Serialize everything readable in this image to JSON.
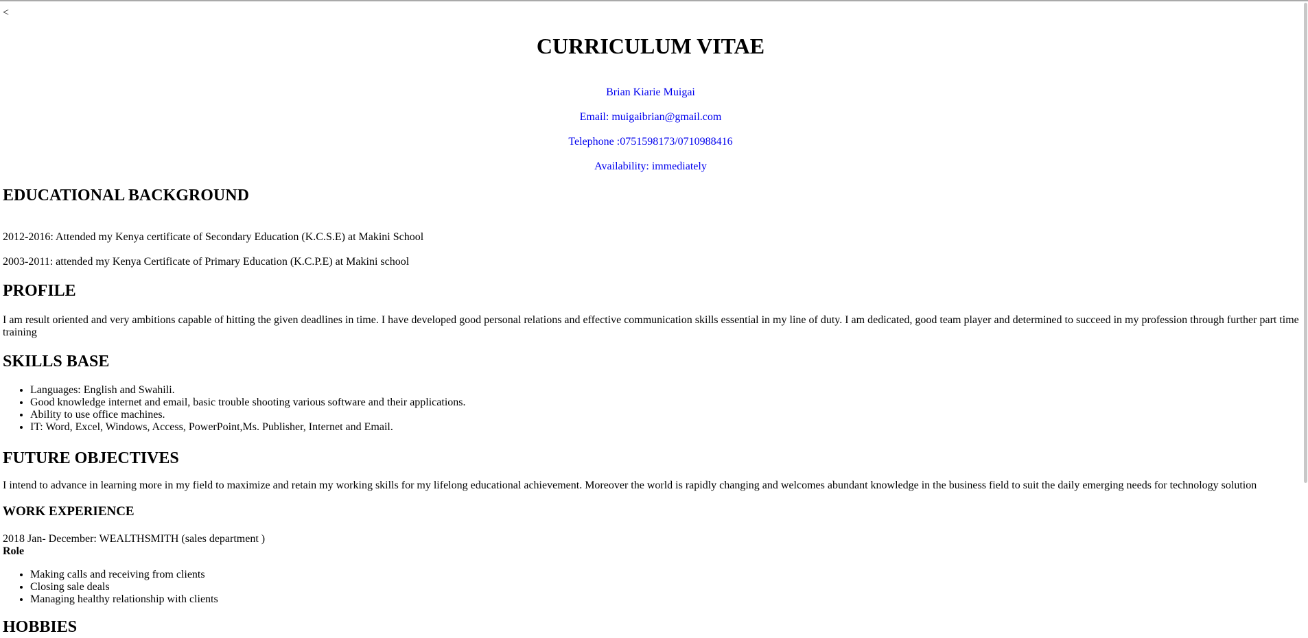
{
  "back_text": "<",
  "title": "CURRICULUM VITAE",
  "contact": {
    "name": "Brian Kiarie Muigai",
    "email": "Email: muigaibrian@gmail.com",
    "telephone": "Telephone :0751598173/0710988416",
    "availability": "Availability: immediately",
    "link_color": "#0000ee"
  },
  "education": {
    "heading": "EDUCATIONAL BACKGROUND",
    "items": [
      "2012-2016: Attended my Kenya certificate of Secondary Education (K.C.S.E) at Makini School",
      "2003-2011: attended my Kenya Certificate of Primary Education (K.C.P.E) at Makini school"
    ]
  },
  "profile": {
    "heading": "PROFILE",
    "text": "I am result oriented and very ambitions capable of hitting the given deadlines in time. I have developed good personal relations and effective communication skills essential in my line of duty. I am dedicated, good team player and determined to succeed in my profession through further part time training"
  },
  "skills": {
    "heading": "SKILLS BASE",
    "items": [
      "Languages: English and Swahili.",
      "Good knowledge internet and email, basic trouble shooting various software and their applications.",
      "Ability to use office machines.",
      "IT: Word, Excel, Windows, Access, PowerPoint,Ms. Publisher, Internet and Email."
    ]
  },
  "objectives": {
    "heading": "FUTURE OBJECTIVES",
    "text": "I intend to advance in learning more in my field to maximize and retain my working skills for my lifelong educational achievement. Moreover the world is rapidly changing and welcomes abundant knowledge in the business field to suit the daily emerging needs for technology solution"
  },
  "work": {
    "heading": "WORK EXPERIENCE",
    "entry": "2018 Jan- December: WEALTHSMITH (sales department )",
    "role_label": "Role",
    "items": [
      "Making calls and receiving from clients",
      "Closing sale deals",
      "Managing healthy relationship with clients"
    ]
  },
  "hobbies": {
    "heading": "HOBBIES"
  }
}
